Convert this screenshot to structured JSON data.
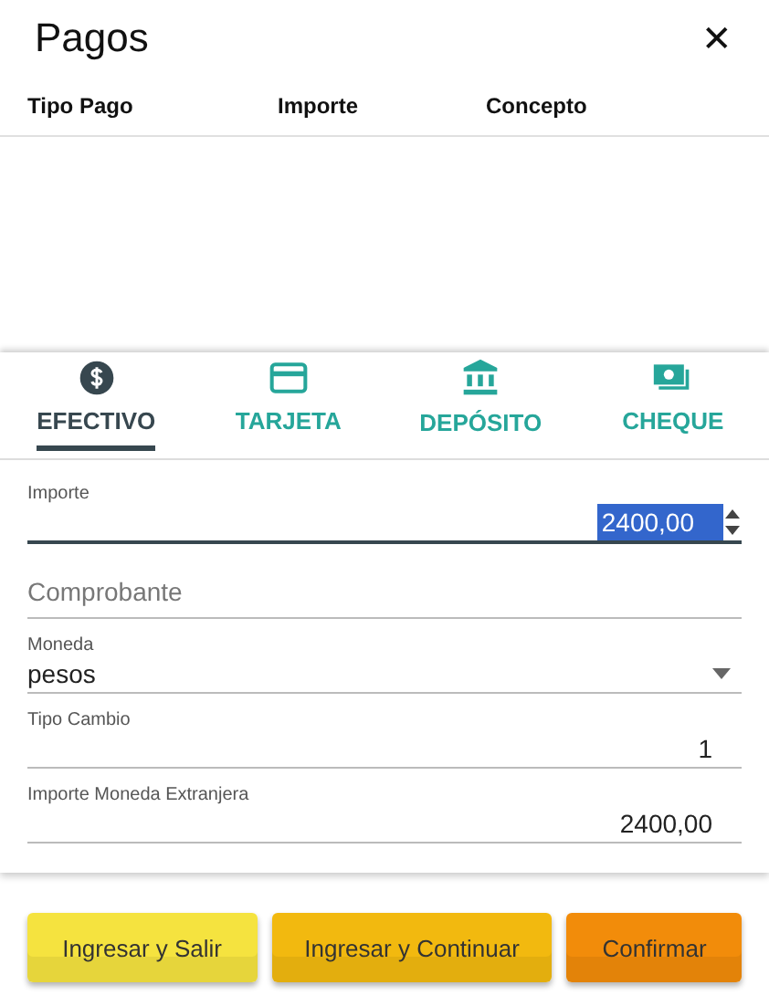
{
  "window": {
    "title": "Pagos",
    "close": "✕"
  },
  "table": {
    "columns": [
      "Tipo Pago",
      "Importe",
      "Concepto"
    ]
  },
  "tabs": [
    {
      "label": "EFECTIVO",
      "kind": "dollar",
      "selected": true
    },
    {
      "label": "TARJETA",
      "kind": "card",
      "selected": false
    },
    {
      "label": "DEPÓSITO",
      "kind": "bank",
      "selected": false
    },
    {
      "label": "CHEQUE",
      "kind": "cash",
      "selected": false
    }
  ],
  "fields": [
    {
      "kind": "number",
      "label": "Importe",
      "value": "2400,00",
      "focused": true
    },
    {
      "kind": "text",
      "placeholder": "Comprobante",
      "focused": false
    },
    {
      "kind": "select",
      "label": "Moneda",
      "value": "pesos",
      "focused": false
    },
    {
      "kind": "number",
      "label": "Tipo Cambio",
      "value": "1",
      "focused": false
    },
    {
      "kind": "number",
      "label": "Importe Moneda Extranjera",
      "value": "2400,00",
      "focused": false
    }
  ],
  "buttons": [
    {
      "label": "Ingresar y Salir",
      "color": "#f5e33f"
    },
    {
      "label": "Ingresar y Continuar",
      "color": "#f2b90f"
    },
    {
      "label": "Confirmar",
      "color": "#f28c0a"
    }
  ]
}
